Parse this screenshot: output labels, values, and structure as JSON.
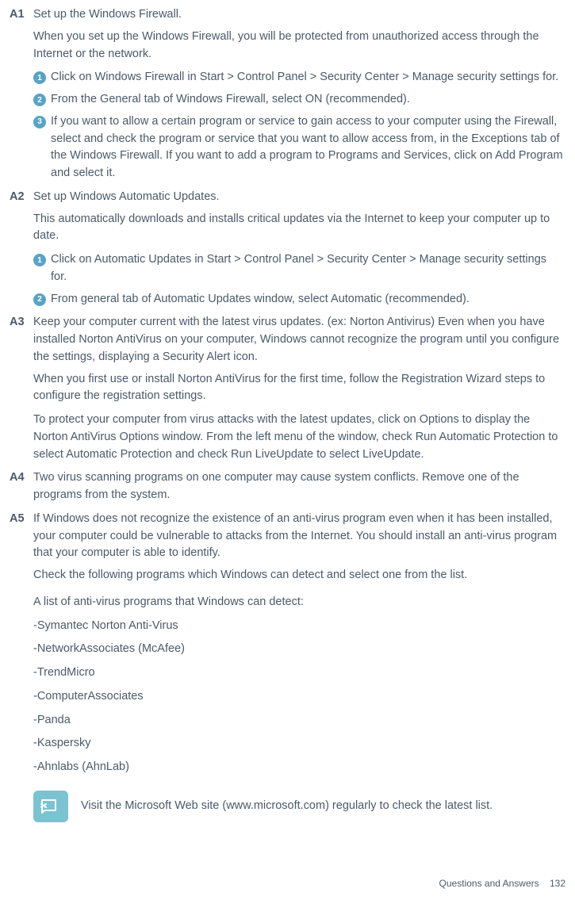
{
  "answers": [
    {
      "label": "A1",
      "title": "Set up the Windows Firewall.",
      "paras": [
        "When you set up the Windows Firewall, you will be protected from unauthorized access through the Internet or the network."
      ],
      "steps": [
        "Click on Windows Firewall in Start > Control Panel > Security Center > Manage security settings for.",
        "From the General tab of Windows Firewall, select ON (recommended).",
        "If you want to allow a certain program or service to gain access to your computer using the Firewall, select and check the program or service that you want to allow access from, in the Exceptions tab of the Windows Firewall. If you want to add a program to Programs and Services, click on Add Program and select it."
      ]
    },
    {
      "label": "A2",
      "title": "Set up Windows Automatic Updates.",
      "paras": [
        "This automatically downloads and installs critical updates via the Internet to keep your computer up to date."
      ],
      "steps": [
        "Click on Automatic Updates in Start > Control Panel > Security Center > Manage security settings for.",
        "From general tab of Automatic Updates window, select Automatic (recommended)."
      ]
    },
    {
      "label": "A3",
      "title": "Keep your computer current with the latest virus updates. (ex: Norton Antivirus) Even when you have installed Norton AntiVirus on your computer, Windows cannot recognize the program until you configure the settings, displaying a Security Alert icon.",
      "paras": [
        "When you first use or install Norton AntiVirus for the first time, follow the Registration Wizard steps to configure the registration settings.",
        "To protect your computer from virus attacks with the latest updates, click on Options to display the Norton AntiVirus Options window. From the left menu of the window, check Run Automatic Protection to select Automatic Protection and check Run LiveUpdate to select LiveUpdate."
      ],
      "steps": []
    },
    {
      "label": "A4",
      "title": "Two virus scanning programs on one computer may cause system conflicts. Remove one of the programs from the system.",
      "paras": [],
      "steps": []
    },
    {
      "label": "A5",
      "title": "If Windows does not recognize the existence of an anti-virus program even when it has been installed, your computer could be vulnerable to attacks from the Internet. You should install an anti-virus program that your computer is able to identify.",
      "paras": [
        "Check the following programs which Windows can detect and select one from the list."
      ],
      "steps": []
    }
  ],
  "av_list_intro": "A list of anti-virus programs that Windows can detect:",
  "av_list": [
    "-Symantec Norton Anti-Virus",
    "-NetworkAssociates (McAfee)",
    "-TrendMicro",
    "-ComputerAssociates",
    "-Panda",
    "-Kaspersky",
    "-Ahnlabs (AhnLab)"
  ],
  "note": "Visit the Microsoft Web site (www.microsoft.com) regularly to check the latest list.",
  "footer_section": "Questions and Answers",
  "footer_page": "132",
  "step_glyphs": [
    "1",
    "2",
    "3"
  ]
}
